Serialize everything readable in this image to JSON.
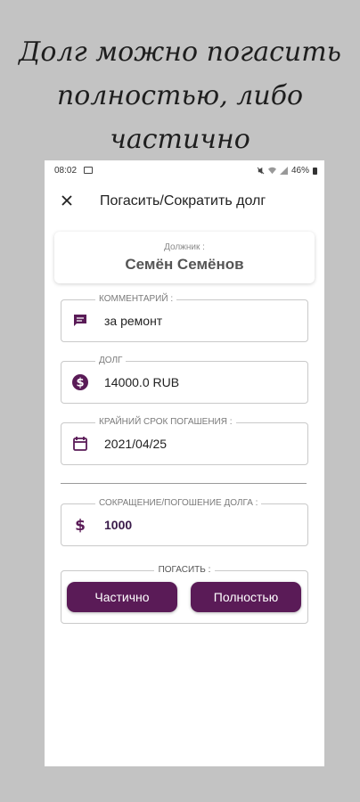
{
  "promo": {
    "line1": "Долг можно погасить",
    "line2": "полностью, либо частично"
  },
  "status_bar": {
    "time": "08:02",
    "battery": "46%"
  },
  "header": {
    "title": "Погасить/Сократить долг"
  },
  "debtor": {
    "label": "Должник :",
    "name": "Семён Семёнов"
  },
  "fields": {
    "comment": {
      "label": "КОММЕНТАРИЙ :",
      "value": "за ремонт",
      "icon": "comment-icon"
    },
    "debt": {
      "label": "ДОЛГ",
      "value": "14000.0 RUB",
      "icon": "dollar-circle-icon"
    },
    "deadline": {
      "label": "КРАЙНИЙ СРОК ПОГАШЕНИЯ :",
      "value": "2021/04/25",
      "icon": "calendar-icon"
    },
    "reduction": {
      "label": "СОКРАЩЕНИЕ/ПОГОШЕНИЕ ДОЛГА :",
      "value": "1000",
      "icon": "dollar-sign-icon"
    }
  },
  "repay": {
    "label": "ПОГАСИТЬ :",
    "partial_button": "Частично",
    "full_button": "Полностью"
  },
  "colors": {
    "accent": "#5a1b57",
    "background": "#c3c3c3"
  }
}
